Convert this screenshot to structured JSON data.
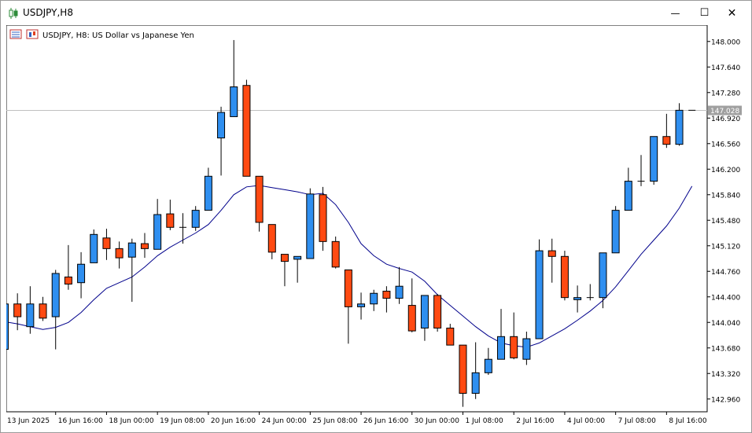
{
  "window": {
    "title": "USDJPY,H8",
    "minimize_label": "—",
    "maximize_label": "☐",
    "close_label": "✕"
  },
  "chart_header": {
    "text": "USDJPY, H8:  US Dollar vs Japanese Yen"
  },
  "colors": {
    "bull": "#2f8ff0",
    "bear": "#ff4a12",
    "candle_border": "#000000",
    "ma_line": "#00008b",
    "price_line": "#c0c0c0",
    "current_price_bg": "#a0a0a0"
  },
  "chart_data": {
    "type": "candlestick",
    "symbol": "USDJPY",
    "timeframe": "H8",
    "ylim": [
      142.78,
      148.23
    ],
    "y_ticks": [
      "148.000",
      "147.640",
      "147.280",
      "146.920",
      "146.560",
      "146.200",
      "145.840",
      "145.480",
      "145.120",
      "144.760",
      "144.400",
      "144.040",
      "143.680",
      "143.320",
      "142.960"
    ],
    "x_labels": [
      {
        "index": 0,
        "label": "13 Jun 2025"
      },
      {
        "index": 4,
        "label": "16 Jun 16:00"
      },
      {
        "index": 8,
        "label": "18 Jun 00:00"
      },
      {
        "index": 12,
        "label": "19 Jun 08:00"
      },
      {
        "index": 16,
        "label": "20 Jun 16:00"
      },
      {
        "index": 20,
        "label": "24 Jun 00:00"
      },
      {
        "index": 24,
        "label": "25 Jun 08:00"
      },
      {
        "index": 28,
        "label": "26 Jun 16:00"
      },
      {
        "index": 32,
        "label": "30 Jun 00:00"
      },
      {
        "index": 36,
        "label": "1 Jul 08:00"
      },
      {
        "index": 40,
        "label": "2 Jul 16:00"
      },
      {
        "index": 44,
        "label": "4 Jul 00:00"
      },
      {
        "index": 48,
        "label": "7 Jul 08:00"
      },
      {
        "index": 52,
        "label": "8 Jul 16:00"
      }
    ],
    "current_price": "147.028",
    "candles": [
      {
        "o": 143.66,
        "h": 144.3,
        "l": 143.66,
        "c": 144.3
      },
      {
        "o": 144.3,
        "h": 144.45,
        "l": 143.93,
        "c": 144.12
      },
      {
        "o": 143.98,
        "h": 144.55,
        "l": 143.88,
        "c": 144.3
      },
      {
        "o": 144.3,
        "h": 144.4,
        "l": 144.06,
        "c": 144.1
      },
      {
        "o": 144.12,
        "h": 144.78,
        "l": 143.66,
        "c": 144.73
      },
      {
        "o": 144.68,
        "h": 145.13,
        "l": 144.5,
        "c": 144.58
      },
      {
        "o": 144.6,
        "h": 145.03,
        "l": 144.38,
        "c": 144.86
      },
      {
        "o": 144.88,
        "h": 145.35,
        "l": 144.88,
        "c": 145.28
      },
      {
        "o": 145.23,
        "h": 145.36,
        "l": 144.92,
        "c": 145.08
      },
      {
        "o": 145.08,
        "h": 145.18,
        "l": 144.8,
        "c": 144.95
      },
      {
        "o": 144.96,
        "h": 145.22,
        "l": 144.33,
        "c": 145.16
      },
      {
        "o": 145.15,
        "h": 145.3,
        "l": 144.95,
        "c": 145.08
      },
      {
        "o": 145.07,
        "h": 145.78,
        "l": 145.07,
        "c": 145.56
      },
      {
        "o": 145.57,
        "h": 145.77,
        "l": 145.34,
        "c": 145.38
      },
      {
        "o": 145.38,
        "h": 145.58,
        "l": 145.15,
        "c": 145.38
      },
      {
        "o": 145.38,
        "h": 145.68,
        "l": 145.33,
        "c": 145.62
      },
      {
        "o": 145.62,
        "h": 146.22,
        "l": 145.62,
        "c": 146.1
      },
      {
        "o": 146.64,
        "h": 147.08,
        "l": 146.11,
        "c": 147.0
      },
      {
        "o": 146.94,
        "h": 148.02,
        "l": 146.94,
        "c": 147.36
      },
      {
        "o": 147.38,
        "h": 147.46,
        "l": 146.1,
        "c": 146.1
      },
      {
        "o": 146.1,
        "h": 146.1,
        "l": 145.32,
        "c": 145.45
      },
      {
        "o": 145.42,
        "h": 145.42,
        "l": 144.93,
        "c": 145.03
      },
      {
        "o": 145.0,
        "h": 145.0,
        "l": 144.55,
        "c": 144.9
      },
      {
        "o": 144.93,
        "h": 144.93,
        "l": 144.6,
        "c": 144.97
      },
      {
        "o": 144.94,
        "h": 145.93,
        "l": 144.94,
        "c": 145.85
      },
      {
        "o": 145.84,
        "h": 145.95,
        "l": 145.05,
        "c": 145.18
      },
      {
        "o": 145.18,
        "h": 145.25,
        "l": 144.8,
        "c": 144.82
      },
      {
        "o": 144.78,
        "h": 144.78,
        "l": 143.74,
        "c": 144.26
      },
      {
        "o": 144.26,
        "h": 144.46,
        "l": 144.08,
        "c": 144.3
      },
      {
        "o": 144.3,
        "h": 144.5,
        "l": 144.2,
        "c": 144.45
      },
      {
        "o": 144.48,
        "h": 144.55,
        "l": 144.18,
        "c": 144.38
      },
      {
        "o": 144.38,
        "h": 144.82,
        "l": 144.3,
        "c": 144.55
      },
      {
        "o": 144.28,
        "h": 144.66,
        "l": 143.9,
        "c": 143.92
      },
      {
        "o": 143.96,
        "h": 144.42,
        "l": 143.78,
        "c": 144.42
      },
      {
        "o": 144.42,
        "h": 144.44,
        "l": 143.91,
        "c": 143.96
      },
      {
        "o": 143.96,
        "h": 144.02,
        "l": 143.72,
        "c": 143.72
      },
      {
        "o": 143.72,
        "h": 143.72,
        "l": 142.85,
        "c": 143.04
      },
      {
        "o": 143.04,
        "h": 143.76,
        "l": 142.96,
        "c": 143.33
      },
      {
        "o": 143.33,
        "h": 143.68,
        "l": 143.3,
        "c": 143.52
      },
      {
        "o": 143.52,
        "h": 144.23,
        "l": 143.52,
        "c": 143.84
      },
      {
        "o": 143.84,
        "h": 144.18,
        "l": 143.52,
        "c": 143.54
      },
      {
        "o": 143.52,
        "h": 143.91,
        "l": 143.44,
        "c": 143.81
      },
      {
        "o": 143.81,
        "h": 145.21,
        "l": 143.81,
        "c": 145.05
      },
      {
        "o": 145.05,
        "h": 145.22,
        "l": 144.6,
        "c": 144.97
      },
      {
        "o": 144.97,
        "h": 145.05,
        "l": 144.35,
        "c": 144.39
      },
      {
        "o": 144.36,
        "h": 144.56,
        "l": 144.18,
        "c": 144.39
      },
      {
        "o": 144.39,
        "h": 144.58,
        "l": 144.35,
        "c": 144.39
      },
      {
        "o": 144.39,
        "h": 145.02,
        "l": 144.24,
        "c": 145.02
      },
      {
        "o": 145.02,
        "h": 145.68,
        "l": 145.02,
        "c": 145.62
      },
      {
        "o": 145.62,
        "h": 146.22,
        "l": 145.62,
        "c": 146.03
      },
      {
        "o": 146.03,
        "h": 146.4,
        "l": 145.96,
        "c": 146.03
      },
      {
        "o": 146.03,
        "h": 146.66,
        "l": 145.98,
        "c": 146.66
      },
      {
        "o": 146.66,
        "h": 146.98,
        "l": 146.5,
        "c": 146.55
      },
      {
        "o": 146.55,
        "h": 147.13,
        "l": 146.53,
        "c": 147.03
      },
      {
        "o": 147.03,
        "h": 147.03,
        "l": 147.03,
        "c": 147.03
      }
    ],
    "ma": [
      144.05,
      144.02,
      143.98,
      143.94,
      143.97,
      144.04,
      144.18,
      144.36,
      144.52,
      144.6,
      144.68,
      144.82,
      144.98,
      145.1,
      145.2,
      145.3,
      145.42,
      145.62,
      145.84,
      145.95,
      145.97,
      145.94,
      145.91,
      145.88,
      145.84,
      145.86,
      145.7,
      145.45,
      145.15,
      144.98,
      144.86,
      144.8,
      144.75,
      144.62,
      144.43,
      144.28,
      144.13,
      143.98,
      143.85,
      143.75,
      143.71,
      143.69,
      143.75,
      143.85,
      143.95,
      144.07,
      144.2,
      144.35,
      144.54,
      144.77,
      145.0,
      145.2,
      145.4,
      145.65,
      145.96
    ]
  }
}
